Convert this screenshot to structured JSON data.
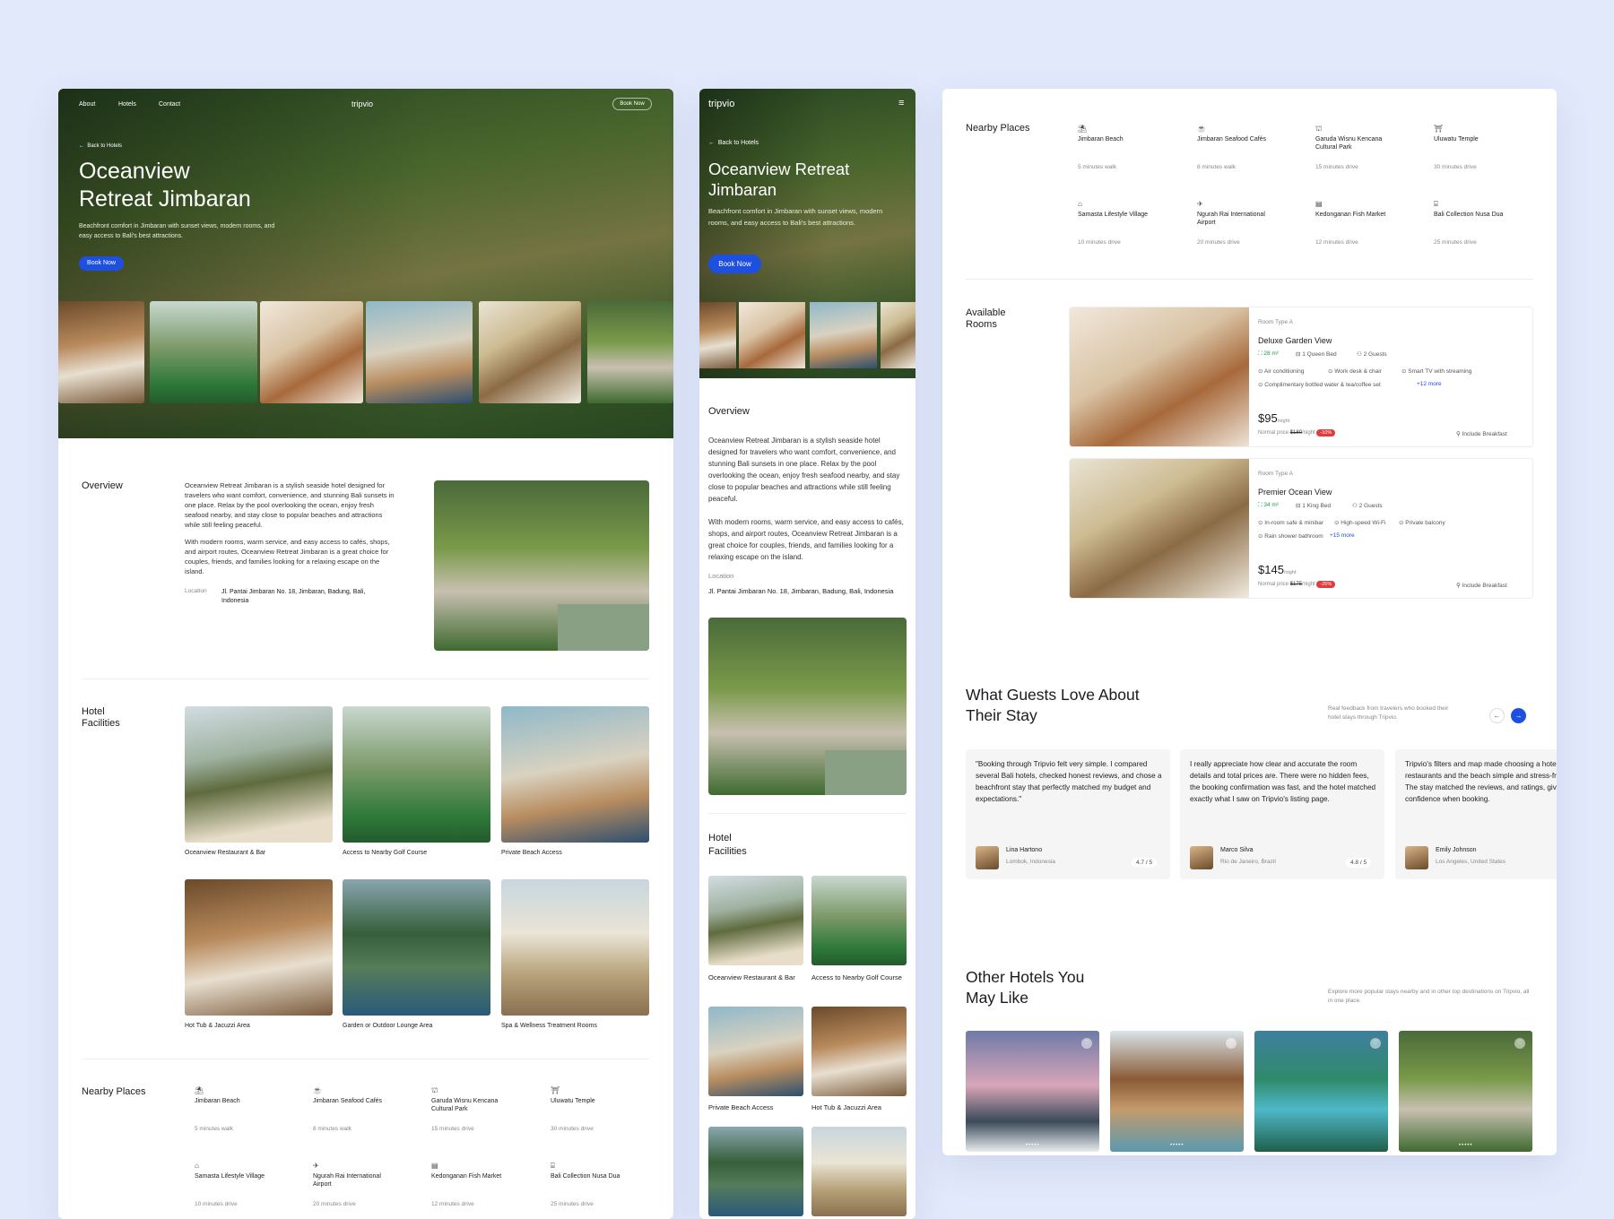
{
  "brand": "tripvio",
  "nav": {
    "about": "About",
    "hotels": "Hotels",
    "contact": "Contact",
    "book": "Book Now"
  },
  "hero": {
    "back": "Back to Hotels",
    "title_line1": "Oceanview",
    "title_line2": "Retreat Jimbaran",
    "mobile_title_line1": "Oceanview Retreat",
    "mobile_title_line2": "Jimbaran",
    "subtitle": "Beachfront comfort in Jimbaran with sunset views, modern rooms, and easy access to Bali's best attractions.",
    "book": "Book Now"
  },
  "overview": {
    "heading": "Overview",
    "p1": "Oceanview Retreat Jimbaran is a stylish seaside hotel designed for travelers who want comfort, convenience, and stunning Bali sunsets in one place. Relax by the pool overlooking the ocean, enjoy fresh seafood nearby, and stay close to popular beaches and attractions while still feeling peaceful.",
    "p2": "With modern rooms, warm service, and easy access to cafés, shops, and airport routes, Oceanview Retreat Jimbaran is a great choice for couples, friends, and families looking for a relaxing escape on the island.",
    "location_label": "Location",
    "location": "Jl. Pantai Jimbaran No. 18, Jimbaran, Badung, Bali, Indonesia"
  },
  "facilities": {
    "heading_line1": "Hotel",
    "heading_line2": "Facilities",
    "items": [
      "Oceanview Restaurant & Bar",
      "Access to Nearby Golf Course",
      "Private Beach Access",
      "Hot Tub & Jacuzzi Area",
      "Garden or Outdoor Lounge Area",
      "Spa & Wellness Treatment Rooms"
    ]
  },
  "nearby": {
    "heading": "Nearby Places",
    "items": [
      {
        "name": "Jimbaran Beach",
        "dist": "5 minutes walk",
        "icon": "beach-icon"
      },
      {
        "name": "Jimbaran Seafood Cafés",
        "dist": "8 minutes walk",
        "icon": "cafe-icon"
      },
      {
        "name": "Garuda Wisnu Kencana Cultural Park",
        "dist": "15 minutes drive",
        "icon": "landmark-icon"
      },
      {
        "name": "Uluwatu Temple",
        "dist": "30 minutes drive",
        "icon": "temple-icon"
      },
      {
        "name": "Samasta Lifestyle Village",
        "dist": "10 minutes drive",
        "icon": "home-icon"
      },
      {
        "name": "Ngurah Rai International Airport",
        "dist": "20 minutes drive",
        "icon": "plane-icon"
      },
      {
        "name": "Kedonganan Fish Market",
        "dist": "12 minutes drive",
        "icon": "market-icon"
      },
      {
        "name": "Bali Collection Nusa Dua",
        "dist": "25 minutes drive",
        "icon": "shop-icon"
      }
    ]
  },
  "rooms": {
    "heading_line1": "Available",
    "heading_line2": "Rooms",
    "items": [
      {
        "type": "Room Type A",
        "name": "Deluxe Garden View",
        "size": "28 m²",
        "bed": "1 Queen Bed",
        "guests": "2 Guests",
        "f1": "Air conditioning",
        "f2": "Work desk & chair",
        "f3": "Smart TV with streaming",
        "f4": "Complimentary bottled water & tea/coffee set",
        "more": "+12 more",
        "price": "$95",
        "per": "/night",
        "normal_label": "Normal price",
        "normal": "$180",
        "normal_per": "/night",
        "discount": "-10%",
        "breakfast": "Include Breakfast"
      },
      {
        "type": "Room Type A",
        "name": "Premier Ocean View",
        "size": "34 m²",
        "bed": "1 King Bed",
        "guests": "2 Guests",
        "f1": "In-room safe & minibar",
        "f2": "High-speed Wi-Fi",
        "f3": "Private balcony",
        "f4": "Rain shower bathroom",
        "more": "+15 more",
        "price": "$145",
        "per": "/night",
        "normal_label": "Normal price",
        "normal": "$175",
        "normal_per": "/night",
        "discount": "-25%",
        "breakfast": "Include Breakfast"
      }
    ]
  },
  "reviews": {
    "heading_line1": "What Guests Love About",
    "heading_line2": "Their Stay",
    "sub": "Real feedback from travelers who booked their hotel stays through Tripvio.",
    "items": [
      {
        "text": "\"Booking through Tripvio felt very simple. I compared several Bali hotels, checked honest reviews, and chose a beachfront stay that perfectly matched my budget and expectations.\"",
        "name": "Lina Hartono",
        "place": "Lombok, Indonesia",
        "rating": "4.7 / 5"
      },
      {
        "text": "I really appreciate how clear and accurate the room details and total prices are. There were no hidden fees, the booking confirmation was fast, and the hotel matched exactly what I saw on Tripvio's listing page.",
        "name": "Marco Silva",
        "place": "Rio de Janeiro, Brazil",
        "rating": "4.8 / 5"
      },
      {
        "text": "Tripvio's filters and map made choosing a hotel near restaurants and the beach simple and stress-free. The stay matched the reviews, and ratings, giving me confidence when booking.",
        "name": "Emily Johnson",
        "place": "Los Angeles, United States",
        "rating": ""
      }
    ]
  },
  "other": {
    "heading_line1": "Other Hotels You",
    "heading_line2": "May Like",
    "sub": "Explore more popular stays nearby and in other top destinations on Tripvio, all in one place."
  }
}
